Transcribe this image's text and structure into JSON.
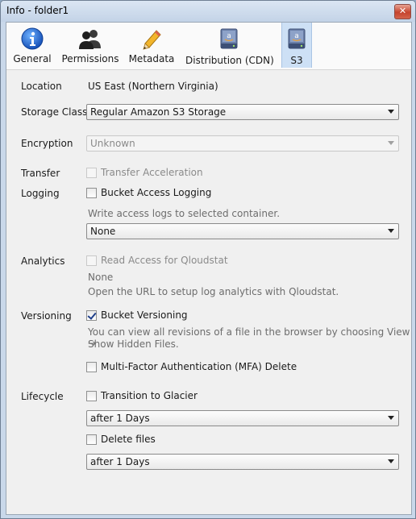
{
  "window": {
    "title": "Info - folder1",
    "close_glyph": "✕"
  },
  "toolbar": {
    "items": [
      {
        "label": "General",
        "icon": "info-icon",
        "selected": false
      },
      {
        "label": "Permissions",
        "icon": "users-icon",
        "selected": false
      },
      {
        "label": "Metadata",
        "icon": "pencil-icon",
        "selected": false
      },
      {
        "label": "Distribution (CDN)",
        "icon": "amazon-drive-icon",
        "selected": false
      },
      {
        "label": "S3",
        "icon": "amazon-drive-icon",
        "selected": true
      }
    ]
  },
  "location": {
    "label": "Location",
    "value": "US East (Northern Virginia)"
  },
  "storage_class": {
    "label": "Storage Class",
    "value": "Regular Amazon S3 Storage"
  },
  "encryption": {
    "label": "Encryption",
    "value": "Unknown"
  },
  "transfer": {
    "label": "Transfer",
    "checkbox_label": "Transfer Acceleration",
    "checked": false,
    "enabled": false
  },
  "logging": {
    "label": "Logging",
    "checkbox_label": "Bucket Access Logging",
    "checked": false,
    "hint": "Write access logs to selected container.",
    "container_value": "None"
  },
  "analytics": {
    "label": "Analytics",
    "checkbox_label": "Read Access for Qloudstat",
    "checked": false,
    "enabled": false,
    "status": "None",
    "hint": "Open the URL to setup log analytics with Qloudstat."
  },
  "versioning": {
    "label": "Versioning",
    "checkbox_label": "Bucket Versioning",
    "checked": true,
    "hint_line1": "You can view all revisions of a file in the browser by choosing View →",
    "hint_line2": "Show Hidden Files.",
    "mfa_label": "Multi-Factor Authentication (MFA) Delete",
    "mfa_checked": false
  },
  "lifecycle": {
    "label": "Lifecycle",
    "transition_label": "Transition to Glacier",
    "transition_checked": false,
    "transition_value": "after 1 Days",
    "delete_label": "Delete files",
    "delete_checked": false,
    "delete_value": "after 1 Days"
  },
  "colors": {
    "selected_tab": "#cde0f5",
    "window_frame": "#c9d8ea",
    "checkmark": "#1f3f8a"
  }
}
